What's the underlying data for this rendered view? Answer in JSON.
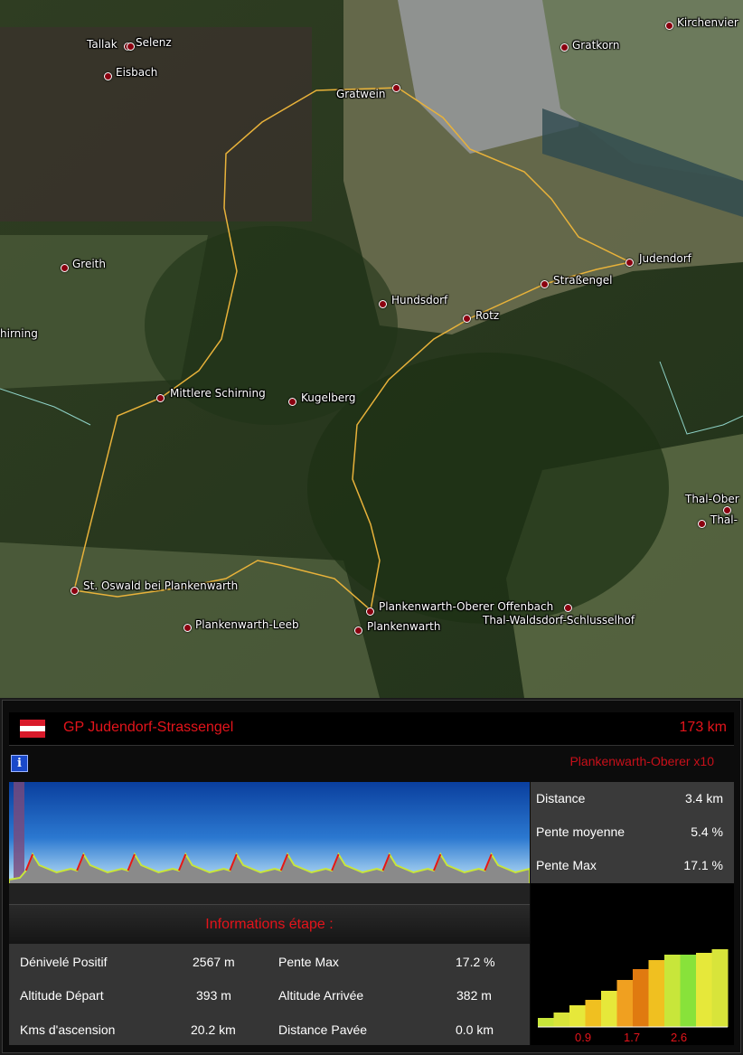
{
  "map": {
    "places": [
      {
        "name": "Tallak",
        "dot": true
      },
      {
        "name": "Selenz",
        "dot": true
      },
      {
        "name": "Eisbach",
        "dot": true
      },
      {
        "name": "Gratwein",
        "dot": true
      },
      {
        "name": "Gratkorn",
        "dot": true
      },
      {
        "name": "Kirchenvier",
        "dot": true
      },
      {
        "name": "Judendorf",
        "dot": true
      },
      {
        "name": "Straßengel",
        "dot": true
      },
      {
        "name": "Greith",
        "dot": true
      },
      {
        "name": "Hundsdorf",
        "dot": true
      },
      {
        "name": "Rotz",
        "dot": true
      },
      {
        "name": "hirning",
        "dot": false
      },
      {
        "name": "Mittlere Schirning",
        "dot": true
      },
      {
        "name": "Kugelberg",
        "dot": true
      },
      {
        "name": "Thal-Ober",
        "dot": true
      },
      {
        "name": "Thal-",
        "dot": true
      },
      {
        "name": "St. Oswald bei Plankenwarth",
        "dot": true
      },
      {
        "name": "Plankenwarth-Oberer Offenbach",
        "dot": true
      },
      {
        "name": "Thal-Waldsdorf-Schlusselhof",
        "dot": true
      },
      {
        "name": "Plankenwarth-Leeb",
        "dot": true
      },
      {
        "name": "Plankenwarth",
        "dot": true
      }
    ]
  },
  "panel": {
    "flag_colors": [
      "#d91a2a",
      "#ffffff",
      "#d91a2a"
    ],
    "race_title": "GP Judendorf-Strassengel",
    "race_distance": "173 km",
    "info_icon": "i",
    "climb_name": "Plankenwarth-Oberer x10",
    "climb_stats": [
      {
        "label": "Distance",
        "value": "3.4 km"
      },
      {
        "label": "Pente moyenne",
        "value": "5.4 %"
      },
      {
        "label": "Pente Max",
        "value": "17.1 %"
      }
    ],
    "info_title": "Informations étape :",
    "stage_info": [
      {
        "label": "Dénivelé Positif",
        "value": "2567 m",
        "label2": "Pente Max",
        "value2": "17.2 %"
      },
      {
        "label": "Altitude Départ",
        "value": "393 m",
        "label2": "Altitude Arrivée",
        "value2": "382 m"
      },
      {
        "label": "Kms d'ascension",
        "value": "20.2 km",
        "label2": "Distance Pavée",
        "value2": "0.0 km"
      }
    ],
    "mini_profile_ticks": [
      "0.9",
      "1.7",
      "2.6"
    ],
    "profile_repeats": 10
  },
  "colors": {
    "accent_red": "#e4141b",
    "route": "#e8b23a"
  }
}
